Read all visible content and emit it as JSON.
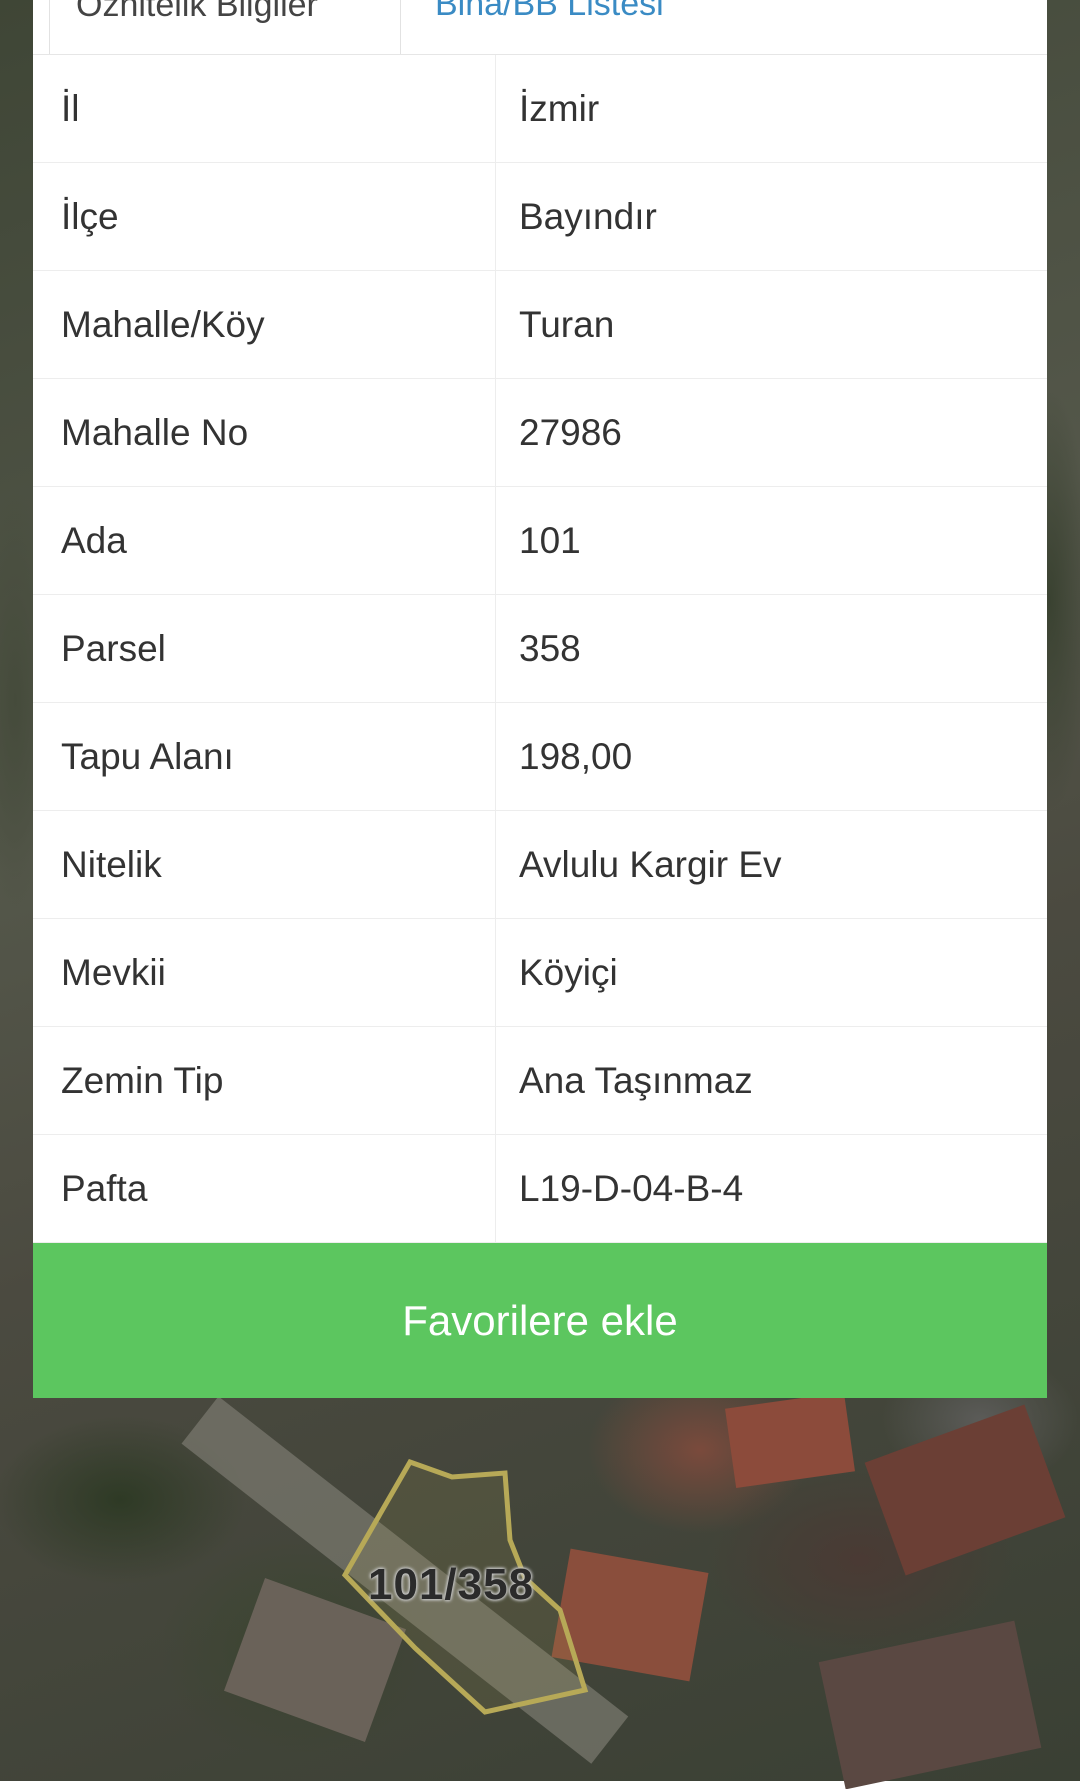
{
  "tabs": [
    {
      "label": "Öznitelik Bilgiler"
    },
    {
      "label": "Bina/BB Listesi"
    }
  ],
  "attributes": [
    {
      "key": "İl",
      "value": "İzmir"
    },
    {
      "key": "İlçe",
      "value": "Bayındır"
    },
    {
      "key": "Mahalle/Köy",
      "value": "Turan"
    },
    {
      "key": "Mahalle No",
      "value": "27986"
    },
    {
      "key": "Ada",
      "value": "101"
    },
    {
      "key": "Parsel",
      "value": "358"
    },
    {
      "key": "Tapu Alanı",
      "value": "198,00"
    },
    {
      "key": "Nitelik",
      "value": "Avlulu Kargir Ev"
    },
    {
      "key": "Mevkii",
      "value": "Köyiçi"
    },
    {
      "key": "Zemin Tip",
      "value": "Ana Taşınmaz"
    },
    {
      "key": "Pafta",
      "value": "L19-D-04-B-4"
    }
  ],
  "favorite_button": {
    "label": "Favorilere ekle"
  },
  "map": {
    "parcel_label": "101/358",
    "parcel_outline_color": "#b7a957"
  },
  "colors": {
    "button_green": "#5cc65f",
    "tab_link_blue": "#3a8bc4"
  }
}
